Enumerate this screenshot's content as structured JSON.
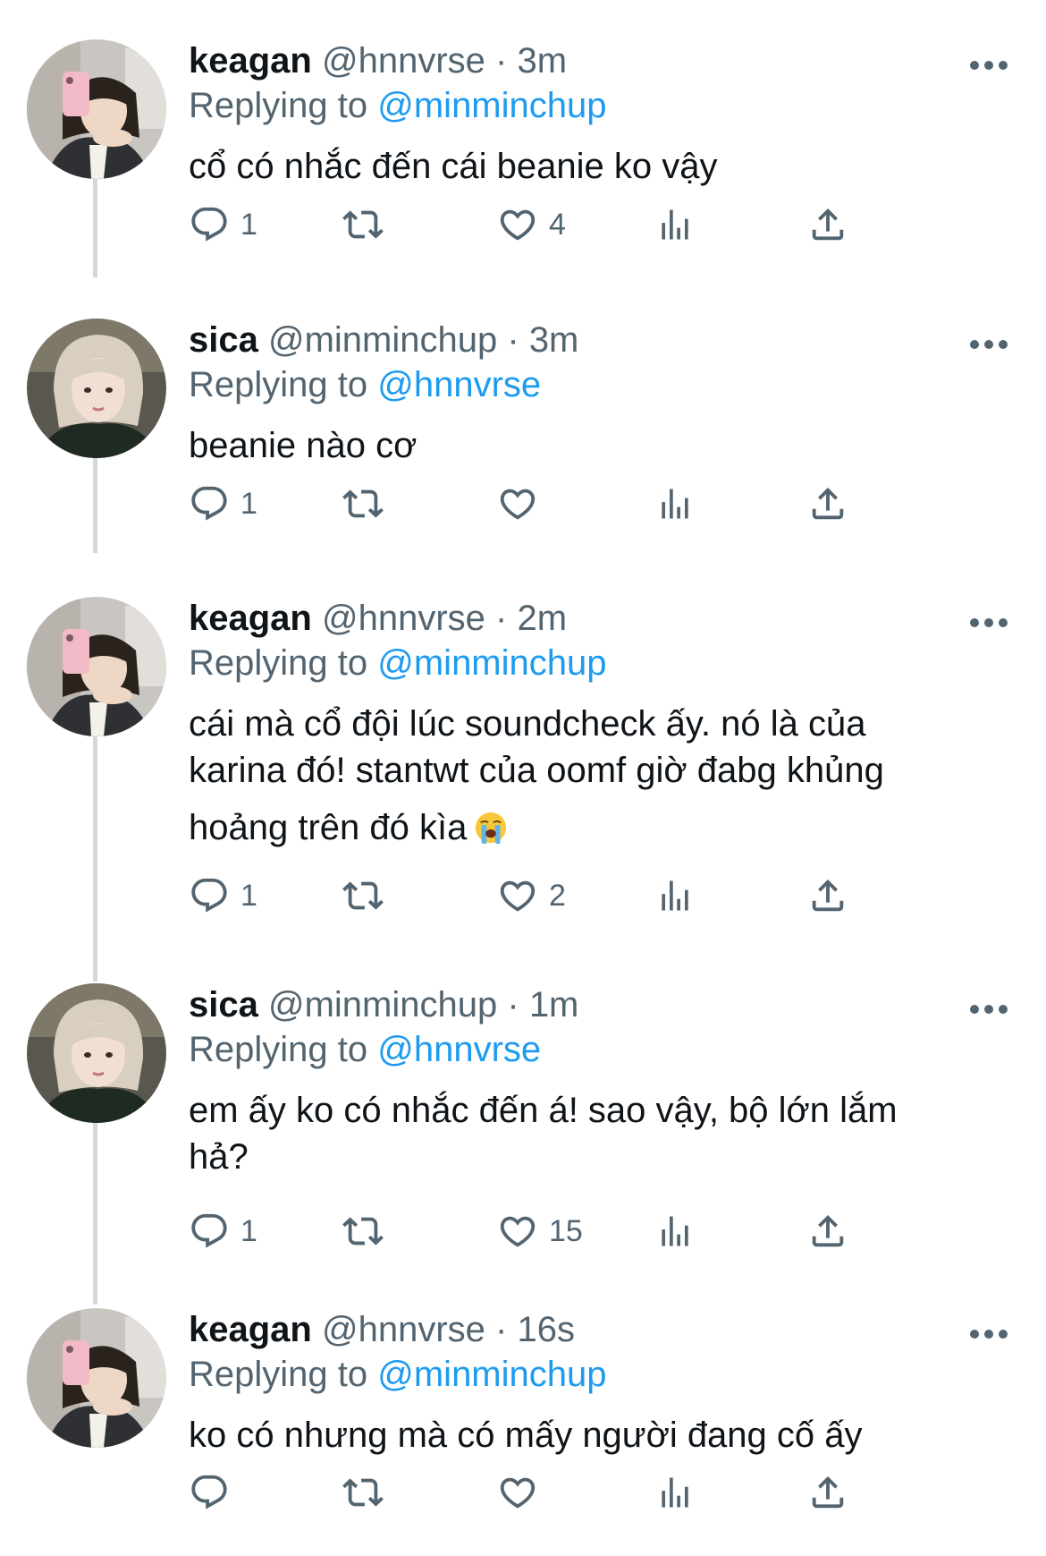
{
  "colors": {
    "text": "#0f1419",
    "secondary": "#536471",
    "link": "#1d9bf0",
    "thread_line": "#cfd9de"
  },
  "icons": {
    "more": "more-dots-icon",
    "reply": "reply-bubble-icon",
    "retweet": "retweet-icon",
    "like": "heart-icon",
    "views": "views-bar-chart-icon",
    "share": "share-upload-icon"
  },
  "replying_prefix": "Replying to",
  "tweets": [
    {
      "name": "keagan",
      "handle": "@hnnvrse",
      "separator": "·",
      "time": "3m",
      "replying_to": "@minminchup",
      "text": "cổ có nhắc đến cái beanie ko vậy",
      "reply_count": "1",
      "retweet_count": "",
      "like_count": "4",
      "avatar": "keagan-avatar"
    },
    {
      "name": "sica",
      "handle": "@minminchup",
      "separator": "·",
      "time": "3m",
      "replying_to": "@hnnvrse",
      "text": "beanie nào cơ",
      "reply_count": "1",
      "retweet_count": "",
      "like_count": "",
      "avatar": "sica-avatar"
    },
    {
      "name": "keagan",
      "handle": "@hnnvrse",
      "separator": "·",
      "time": "2m",
      "replying_to": "@minminchup",
      "text_lines": [
        "cái mà cổ đội lúc soundcheck ấy. nó là của",
        "karina đó! stantwt của oomf giờ đabg khủng",
        "hoảng trên đó kìa"
      ],
      "emoji": "loudly-crying-face-emoji",
      "reply_count": "1",
      "retweet_count": "",
      "like_count": "2",
      "avatar": "keagan-avatar"
    },
    {
      "name": "sica",
      "handle": "@minminchup",
      "separator": "·",
      "time": "1m",
      "replying_to": "@hnnvrse",
      "text_lines": [
        "em ấy ko có nhắc đến á! sao vậy, bộ lớn lắm",
        "hả?"
      ],
      "reply_count": "1",
      "retweet_count": "",
      "like_count": "15",
      "avatar": "sica-avatar"
    },
    {
      "name": "keagan",
      "handle": "@hnnvrse",
      "separator": "·",
      "time": "16s",
      "replying_to": "@minminchup",
      "text": "ko có nhưng mà có mấy người đang cố ấy",
      "reply_count": "",
      "retweet_count": "",
      "like_count": "",
      "avatar": "keagan-avatar"
    }
  ]
}
